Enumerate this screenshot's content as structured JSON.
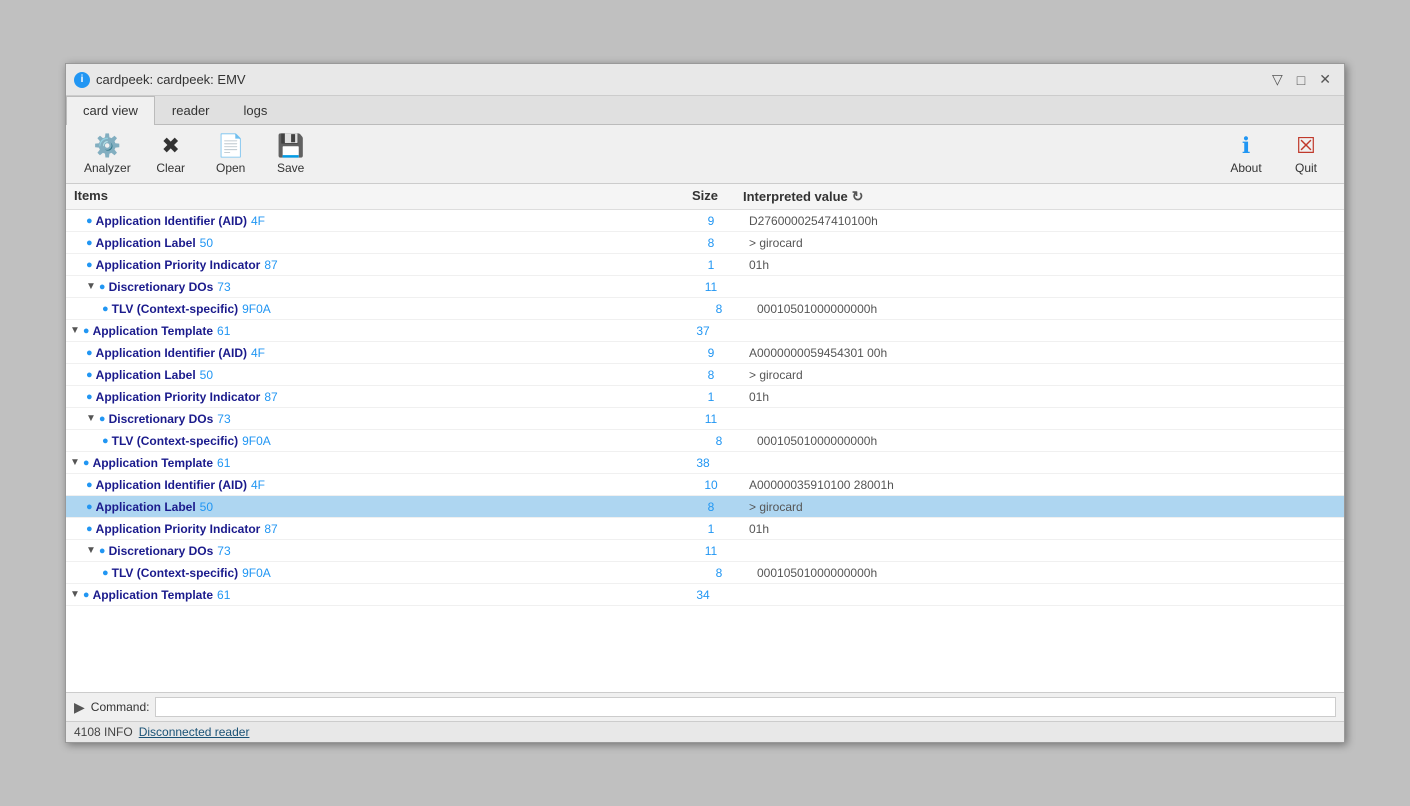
{
  "window": {
    "title": "cardpeek: cardpeek: EMV",
    "icon": "i"
  },
  "tabs": [
    {
      "label": "card view",
      "active": true
    },
    {
      "label": "reader",
      "active": false
    },
    {
      "label": "logs",
      "active": false
    }
  ],
  "toolbar": {
    "analyzer_label": "Analyzer",
    "clear_label": "Clear",
    "open_label": "Open",
    "save_label": "Save",
    "about_label": "About",
    "quit_label": "Quit"
  },
  "table": {
    "col_items": "Items",
    "col_size": "Size",
    "col_value": "Interpreted value"
  },
  "rows": [
    {
      "indent": 1,
      "icon": true,
      "collapse": false,
      "name": "Application Identifier (AID)",
      "tag": "4F",
      "size": "9",
      "value": "D27600002547410100h",
      "selected": false
    },
    {
      "indent": 1,
      "icon": true,
      "collapse": false,
      "name": "Application Label",
      "tag": "50",
      "size": "8",
      "value": "> girocard",
      "selected": false
    },
    {
      "indent": 1,
      "icon": true,
      "collapse": false,
      "name": "Application Priority Indicator",
      "tag": "87",
      "size": "1",
      "value": "01h",
      "selected": false
    },
    {
      "indent": 1,
      "icon": true,
      "collapse": true,
      "name": "Discretionary DOs",
      "tag": "73",
      "size": "11",
      "value": "",
      "selected": false
    },
    {
      "indent": 2,
      "icon": true,
      "collapse": false,
      "name": "TLV (Context-specific)",
      "tag": "9F0A",
      "size": "8",
      "value": "00010501000000000h",
      "selected": false
    },
    {
      "indent": 0,
      "icon": true,
      "collapse": true,
      "name": "Application Template",
      "tag": "61",
      "size": "37",
      "value": "",
      "selected": false
    },
    {
      "indent": 1,
      "icon": true,
      "collapse": false,
      "name": "Application Identifier (AID)",
      "tag": "4F",
      "size": "9",
      "value": "A0000000059454301 00h",
      "selected": false
    },
    {
      "indent": 1,
      "icon": true,
      "collapse": false,
      "name": "Application Label",
      "tag": "50",
      "size": "8",
      "value": "> girocard",
      "selected": false
    },
    {
      "indent": 1,
      "icon": true,
      "collapse": false,
      "name": "Application Priority Indicator",
      "tag": "87",
      "size": "1",
      "value": "01h",
      "selected": false
    },
    {
      "indent": 1,
      "icon": true,
      "collapse": true,
      "name": "Discretionary DOs",
      "tag": "73",
      "size": "11",
      "value": "",
      "selected": false
    },
    {
      "indent": 2,
      "icon": true,
      "collapse": false,
      "name": "TLV (Context-specific)",
      "tag": "9F0A",
      "size": "8",
      "value": "00010501000000000h",
      "selected": false
    },
    {
      "indent": 0,
      "icon": true,
      "collapse": true,
      "name": "Application Template",
      "tag": "61",
      "size": "38",
      "value": "",
      "selected": false
    },
    {
      "indent": 1,
      "icon": true,
      "collapse": false,
      "name": "Application Identifier (AID)",
      "tag": "4F",
      "size": "10",
      "value": "A000000359101002 8001h",
      "selected": false
    },
    {
      "indent": 1,
      "icon": true,
      "collapse": false,
      "name": "Application Label",
      "tag": "50",
      "size": "8",
      "value": "> girocard",
      "selected": true
    },
    {
      "indent": 1,
      "icon": true,
      "collapse": false,
      "name": "Application Priority Indicator",
      "tag": "87",
      "size": "1",
      "value": "01h",
      "selected": false
    },
    {
      "indent": 1,
      "icon": true,
      "collapse": true,
      "name": "Discretionary DOs",
      "tag": "73",
      "size": "11",
      "value": "",
      "selected": false
    },
    {
      "indent": 2,
      "icon": true,
      "collapse": false,
      "name": "TLV (Context-specific)",
      "tag": "9F0A",
      "size": "8",
      "value": "00010501000000000h",
      "selected": false
    },
    {
      "indent": 0,
      "icon": true,
      "collapse": true,
      "name": "Application Template",
      "tag": "61",
      "size": "34",
      "value": "",
      "selected": false
    }
  ],
  "command": {
    "icon": "▶",
    "label": "Command:",
    "placeholder": ""
  },
  "status": {
    "code": "4108 INFO",
    "link": "Disconnected reader"
  }
}
